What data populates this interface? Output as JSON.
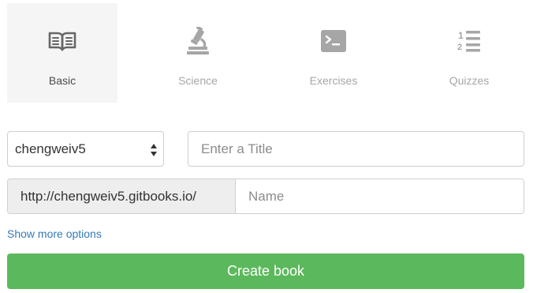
{
  "templates": [
    {
      "label": "Basic",
      "icon": "book-open-icon",
      "selected": true
    },
    {
      "label": "Science",
      "icon": "microscope-icon",
      "selected": false
    },
    {
      "label": "Exercises",
      "icon": "terminal-icon",
      "selected": false
    },
    {
      "label": "Quizzes",
      "icon": "numbered-list-icon",
      "selected": false
    }
  ],
  "form": {
    "owner_value": "chengweiv5",
    "title_placeholder": "Enter a Title",
    "url_prefix": "http://chengweiv5.gitbooks.io/",
    "name_placeholder": "Name",
    "more_options_label": "Show more options",
    "create_label": "Create book"
  },
  "colors": {
    "icon_active": "#666666",
    "icon_inactive": "#a6a6a6",
    "selected_bg": "#f5f5f5",
    "link": "#337ab7",
    "primary_button": "#5cb85c"
  }
}
